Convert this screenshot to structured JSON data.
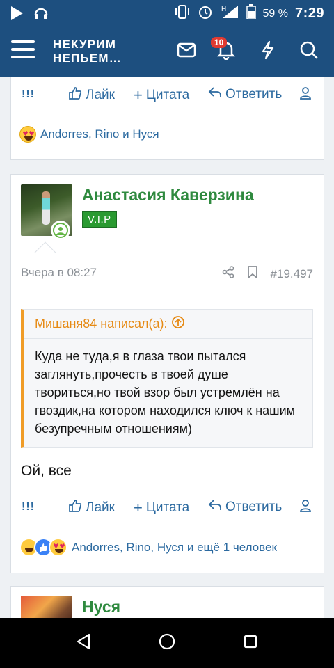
{
  "status_bar": {
    "battery_percent": "59 %",
    "time": "7:29",
    "signal_label": "H"
  },
  "app_bar": {
    "logo_line1": "НЕКУРИМ",
    "logo_line2": "НЕПЬЕМ…",
    "notification_count": "10"
  },
  "post_prev": {
    "actions": {
      "warn": "!!!",
      "like": "Лайк",
      "quote": "Цитата",
      "reply": "Ответить"
    },
    "reactions_text": "Andorres, Rino и Нуся"
  },
  "post_main": {
    "username": "Анастасия Каверзина",
    "badge": "V.I.P",
    "date": "Вчера в 08:27",
    "post_number": "#19.497",
    "quote_author": "Мишаня84 написал(а):",
    "quote_text": "Куда не туда,я в глаза твои пытался заглянуть,прочесть в твоей душе твориться,но твой взор был устремлён на гвоздик,на котором находился ключ к нашим безупречным отношениям)",
    "body": "Ой, все",
    "actions": {
      "warn": "!!!",
      "like": "Лайк",
      "quote": "Цитата",
      "reply": "Ответить"
    },
    "reactions_text": "Andorres, Rino, Нуся и ещё 1 человек"
  },
  "post_next": {
    "username": "Нуся"
  },
  "colors": {
    "header": "#1d4f7f",
    "link": "#2c6aa0",
    "username": "#2f8a3f",
    "quote_accent": "#f09c27"
  }
}
